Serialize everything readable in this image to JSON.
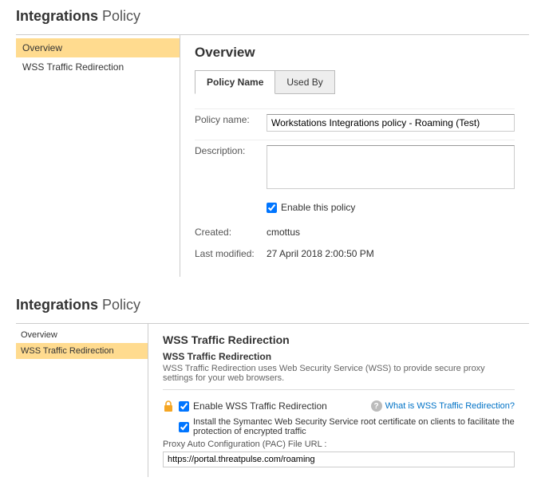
{
  "header": {
    "title_bold": "Integrations",
    "title_light": "Policy"
  },
  "section1": {
    "sidebar": {
      "items": [
        {
          "label": "Overview",
          "active": true
        },
        {
          "label": "WSS Traffic Redirection",
          "active": false
        }
      ]
    },
    "main": {
      "title": "Overview",
      "tabs": [
        {
          "label": "Policy Name",
          "active": true
        },
        {
          "label": "Used By",
          "active": false
        }
      ],
      "policy_name_label": "Policy name:",
      "policy_name_value": "Workstations Integrations policy - Roaming (Test)",
      "description_label": "Description:",
      "description_value": "",
      "enable_checkbox_label": "Enable this policy",
      "enable_checkbox_checked": true,
      "created_label": "Created:",
      "created_value": "cmottus",
      "modified_label": "Last modified:",
      "modified_value": "27 April 2018 2:00:50 PM"
    }
  },
  "section2": {
    "header": {
      "title_bold": "Integrations",
      "title_light": "Policy"
    },
    "sidebar": {
      "items": [
        {
          "label": "Overview",
          "active": false
        },
        {
          "label": "WSS Traffic Redirection",
          "active": true
        }
      ]
    },
    "main": {
      "title": "WSS Traffic Redirection",
      "sub_title": "WSS Traffic Redirection",
      "sub_desc": "WSS Traffic Redirection uses Web Security Service (WSS) to provide secure proxy settings for your web browsers.",
      "enable_wss_label": "Enable WSS Traffic Redirection",
      "enable_wss_checked": true,
      "help_link_text": "What is WSS Traffic Redirection?",
      "install_cert_label": "Install the Symantec Web Security Service root certificate on clients to facilitate the protection of encrypted traffic",
      "install_cert_checked": true,
      "pac_label": "Proxy Auto Configuration (PAC) File URL :",
      "pac_value": "https://portal.threatpulse.com/roaming"
    }
  }
}
